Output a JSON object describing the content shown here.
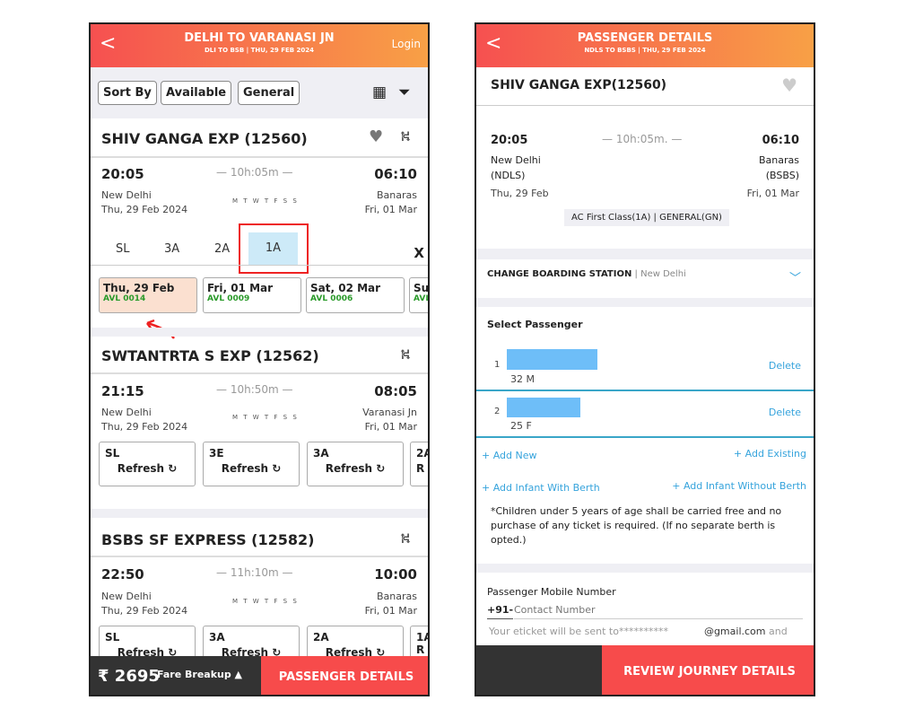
{
  "left": {
    "header": {
      "title": "DELHI TO VARANASI JN",
      "subtitle": "DLI TO BSB | THU, 29 FEB  2024",
      "login": "Login"
    },
    "filters": [
      "Sort By",
      "Available",
      "General"
    ],
    "trains": [
      {
        "name": "SHIV GANGA EXP (12560)",
        "dep": "20:05",
        "arr": "06:10",
        "duration": "10h:05m",
        "days": "M T W T F S S",
        "from": "New Delhi",
        "from_date": "Thu, 29 Feb  2024",
        "to": "Banaras",
        "to_date": "Fri, 01 Mar",
        "classes": [
          "SL",
          "3A",
          "2A",
          "1A"
        ],
        "selected_class": "1A",
        "close": "X",
        "dates": [
          {
            "date": "Thu, 29 Feb",
            "avl": "AVL 0014"
          },
          {
            "date": "Fri, 01 Mar",
            "avl": "AVL 0009"
          },
          {
            "date": "Sat, 02 Mar",
            "avl": "AVL 0006"
          },
          {
            "date": "Su",
            "avl": "AVL"
          }
        ]
      },
      {
        "name": "SWTANTRTA S EXP (12562)",
        "dep": "21:15",
        "arr": "08:05",
        "duration": "10h:50m",
        "days": "M T W T F S S",
        "from": "New Delhi",
        "from_date": "Thu, 29 Feb  2024",
        "to": "Varanasi Jn",
        "to_date": "Fri, 01 Mar",
        "classes": [
          {
            "c": "SL",
            "a": "Refresh"
          },
          {
            "c": "3E",
            "a": "Refresh"
          },
          {
            "c": "3A",
            "a": "Refresh"
          },
          {
            "c": "2A",
            "a": "R"
          }
        ]
      },
      {
        "name": "BSBS SF EXPRESS (12582)",
        "dep": "22:50",
        "arr": "10:00",
        "duration": "11h:10m",
        "days": "M T W T F S S",
        "from": "New Delhi",
        "from_date": "Thu, 29 Feb  2024",
        "to": "Banaras",
        "to_date": "Fri, 01 Mar",
        "classes": [
          {
            "c": "SL",
            "a": "Refresh"
          },
          {
            "c": "3A",
            "a": "Refresh"
          },
          {
            "c": "2A",
            "a": "Refresh"
          },
          {
            "c": "1A",
            "a": "R"
          }
        ]
      }
    ],
    "footer": {
      "price": "₹ 2695",
      "fare": "Fare Breakup ▲",
      "cta": "PASSENGER DETAILS"
    }
  },
  "right": {
    "header": {
      "title": "PASSENGER DETAILS",
      "subtitle": "NDLS TO BSBS |  THU, 29 FEB  2024"
    },
    "train": "SHIV GANGA EXP(12560)",
    "dep": "20:05",
    "arr": "06:10",
    "duration": "10h:05m.",
    "from": "New Delhi",
    "from_code": "(NDLS)",
    "from_date": "Thu, 29 Feb",
    "to": "Banaras",
    "to_code": "(BSBS)",
    "to_date": "Fri, 01 Mar",
    "class_badge": "AC First Class(1A) | GENERAL(GN)",
    "boarding_label": "CHANGE BOARDING STATION",
    "boarding_value": "New Delhi",
    "select_passenger": "Select Passenger",
    "passengers": [
      {
        "n": "1",
        "info": "32 M",
        "delete": "Delete"
      },
      {
        "n": "2",
        "info": "25 F",
        "delete": "Delete"
      }
    ],
    "add_new": "+ Add New",
    "add_existing": "+ Add Existing",
    "add_infant_berth": "+ Add Infant With Berth",
    "add_infant_no_berth": "+ Add Infant Without Berth",
    "note": "*Children under 5 years of age shall be carried free and no purchase of any ticket is required. (If no separate berth is opted.)",
    "mobile_label": "Passenger Mobile Number",
    "code": "+91-",
    "mobile_placeholder": "Contact Number",
    "eticket": "Your eticket will be sent to**********",
    "email": "@gmail.com",
    "and": "and",
    "cta": "REVIEW JOURNEY DETAILS"
  },
  "colors": {
    "accent": "#f65050",
    "header_end": "#f8a046",
    "avl": "#2a9a2a",
    "link": "#35a3dc",
    "redact": "#6ebef8"
  }
}
